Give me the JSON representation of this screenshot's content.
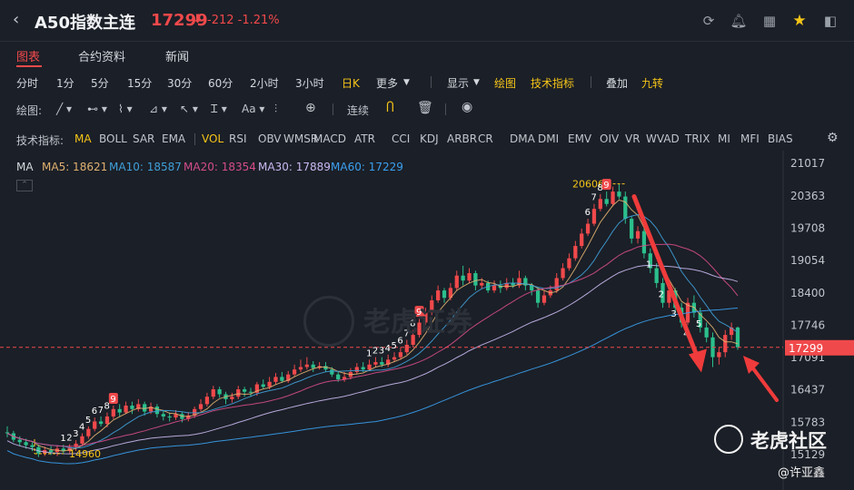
{
  "header": {
    "symbol": "A50指数主连",
    "price": "17299",
    "change": "-212 -1.21%",
    "icons": [
      "back-icon",
      "refresh-icon",
      "bell-icon",
      "grid-icon",
      "star-icon",
      "panel-icon"
    ]
  },
  "tabs": [
    "图表",
    "合约资料",
    "新闻"
  ],
  "periods": [
    "分时",
    "1分",
    "5分",
    "15分",
    "30分",
    "60分",
    "2小时",
    "3小时",
    "日K",
    "更多"
  ],
  "toolbar": {
    "display": "显示",
    "draw": "绘图",
    "tech": "技术指标",
    "overlay": "叠加",
    "nine": "九转"
  },
  "drawbar": {
    "label": "绘图:",
    "continuous": "连续"
  },
  "indicators": {
    "label": "技术指标:",
    "items": [
      "MA",
      "BOLL",
      "SAR",
      "EMA",
      "VOL",
      "RSI",
      "OBV",
      "WMSR",
      "MACD",
      "ATR",
      "CCI",
      "KDJ",
      "ARBR",
      "CR",
      "DMA",
      "DMI",
      "EMV",
      "OIV",
      "VR",
      "WVAD",
      "TRIX",
      "MI",
      "MFI",
      "BIAS"
    ]
  },
  "legend": {
    "title": "MA",
    "items": [
      {
        "label": "MA5: 18621",
        "color": "#e0b070"
      },
      {
        "label": "MA10: 18587",
        "color": "#3f9fd8"
      },
      {
        "label": "MA20: 18354",
        "color": "#d44d8a"
      },
      {
        "label": "MA30: 17889",
        "color": "#c8b8f0"
      },
      {
        "label": "MA60: 17229",
        "color": "#3aa0f0"
      }
    ]
  },
  "colors": {
    "up": "#f0494b",
    "down": "#2bbf8c",
    "accent": "#f0494b",
    "yellow": "#f5c518",
    "bg": "#1b1f27"
  },
  "watermark": "老虎证券",
  "brand": "老虎社区",
  "author": "@许亚鑫",
  "chart_data": {
    "type": "candlestick",
    "y_ticks": [
      21017,
      20363,
      19708,
      19054,
      18400,
      17746,
      17091,
      16437,
      15783,
      15129
    ],
    "ylim": [
      15000,
      21150
    ],
    "last_price": "17299",
    "high_label": "20606",
    "low_label": "14960",
    "td_labels_first": [
      "1",
      "2",
      "3",
      "4",
      "5",
      "6",
      "7",
      "8",
      "9"
    ],
    "td_labels_second": [
      "1",
      "2",
      "3",
      "4",
      "5",
      "6",
      "7",
      "8",
      "9"
    ],
    "td_labels_top": [
      "6",
      "7",
      "8",
      "9"
    ],
    "td_labels_down": [
      "1",
      "2",
      "3",
      "4",
      "5"
    ],
    "candles": [
      [
        15580,
        15560,
        15700,
        15480
      ],
      [
        15560,
        15430,
        15610,
        15380
      ],
      [
        15430,
        15380,
        15500,
        15300
      ],
      [
        15380,
        15320,
        15450,
        15250
      ],
      [
        15320,
        15280,
        15380,
        15200
      ],
      [
        15280,
        15150,
        15330,
        15080
      ],
      [
        15150,
        15220,
        15290,
        15100
      ],
      [
        15220,
        15180,
        15300,
        15120
      ],
      [
        15180,
        15250,
        15320,
        15100
      ],
      [
        15250,
        15200,
        15330,
        15150
      ],
      [
        15200,
        15280,
        15340,
        15150
      ],
      [
        15280,
        15350,
        15420,
        15200
      ],
      [
        15350,
        15500,
        15560,
        15300
      ],
      [
        15500,
        15650,
        15700,
        15450
      ],
      [
        15650,
        15800,
        15880,
        15600
      ],
      [
        15800,
        15750,
        15900,
        15700
      ],
      [
        15750,
        15900,
        15980,
        15680
      ],
      [
        15900,
        16050,
        16120,
        15850
      ],
      [
        16050,
        15980,
        16150,
        15900
      ],
      [
        15980,
        16120,
        16200,
        15950
      ],
      [
        16120,
        16050,
        16200,
        15950
      ],
      [
        16050,
        16150,
        16250,
        16000
      ],
      [
        16150,
        16000,
        16200,
        15920
      ],
      [
        16000,
        16100,
        16180,
        15950
      ],
      [
        16100,
        15950,
        16150,
        15880
      ],
      [
        15950,
        15900,
        16020,
        15820
      ],
      [
        15900,
        15880,
        15980,
        15800
      ],
      [
        15880,
        15950,
        16030,
        15830
      ],
      [
        15950,
        15850,
        16000,
        15780
      ],
      [
        15850,
        15920,
        15990,
        15800
      ],
      [
        15920,
        16050,
        16100,
        15870
      ],
      [
        16050,
        16150,
        16250,
        16000
      ],
      [
        16150,
        16300,
        16380,
        16100
      ],
      [
        16300,
        16450,
        16520,
        16250
      ],
      [
        16450,
        16350,
        16500,
        16280
      ],
      [
        16350,
        16250,
        16400,
        16150
      ],
      [
        16250,
        16300,
        16380,
        16180
      ],
      [
        16300,
        16450,
        16520,
        16250
      ],
      [
        16450,
        16400,
        16500,
        16300
      ],
      [
        16400,
        16380,
        16480,
        16300
      ],
      [
        16380,
        16550,
        16600,
        16320
      ],
      [
        16550,
        16500,
        16650,
        16450
      ],
      [
        16500,
        16600,
        16700,
        16450
      ],
      [
        16600,
        16700,
        16780,
        16550
      ],
      [
        16700,
        16620,
        16800,
        16580
      ],
      [
        16620,
        16750,
        16820,
        16580
      ],
      [
        16750,
        16850,
        16950,
        16700
      ],
      [
        16850,
        16900,
        17050,
        16800
      ],
      [
        16900,
        16950,
        17100,
        16850
      ],
      [
        16950,
        16880,
        17020,
        16800
      ],
      [
        16880,
        16920,
        17000,
        16850
      ],
      [
        16920,
        16850,
        17000,
        16800
      ],
      [
        16850,
        16750,
        16900,
        16700
      ],
      [
        16750,
        16650,
        16800,
        16600
      ],
      [
        16650,
        16700,
        16800,
        16600
      ],
      [
        16700,
        16800,
        16880,
        16650
      ],
      [
        16800,
        16900,
        16980,
        16750
      ],
      [
        16900,
        16850,
        17000,
        16800
      ],
      [
        16850,
        16950,
        17050,
        16820
      ],
      [
        16950,
        17000,
        17100,
        16900
      ],
      [
        17000,
        16950,
        17100,
        16900
      ],
      [
        16950,
        17050,
        17150,
        16900
      ],
      [
        17050,
        17100,
        17200,
        17000
      ],
      [
        17100,
        17200,
        17300,
        17050
      ],
      [
        17200,
        17350,
        17450,
        17150
      ],
      [
        17350,
        17550,
        17650,
        17300
      ],
      [
        17550,
        17800,
        17880,
        17500
      ],
      [
        17800,
        18000,
        18100,
        17750
      ],
      [
        18000,
        18250,
        18350,
        17950
      ],
      [
        18250,
        18450,
        18550,
        18200
      ],
      [
        18450,
        18300,
        18500,
        18200
      ],
      [
        18300,
        18500,
        18600,
        18250
      ],
      [
        18500,
        18750,
        18850,
        18450
      ],
      [
        18750,
        18650,
        18950,
        18550
      ],
      [
        18650,
        18800,
        18900,
        18600
      ],
      [
        18800,
        18550,
        18850,
        18450
      ],
      [
        18550,
        18600,
        18700,
        18480
      ],
      [
        18600,
        18450,
        18650,
        18400
      ],
      [
        18450,
        18550,
        18650,
        18400
      ],
      [
        18550,
        18500,
        18650,
        18400
      ],
      [
        18500,
        18600,
        18700,
        18450
      ],
      [
        18600,
        18550,
        18700,
        18500
      ],
      [
        18550,
        18700,
        18850,
        18500
      ],
      [
        18700,
        18550,
        18750,
        18450
      ],
      [
        18550,
        18450,
        18600,
        18350
      ],
      [
        18450,
        18200,
        18500,
        18100
      ],
      [
        18200,
        18350,
        18450,
        18150
      ],
      [
        18350,
        18450,
        18550,
        18300
      ],
      [
        18450,
        18700,
        18800,
        18400
      ],
      [
        18700,
        18900,
        19000,
        18650
      ],
      [
        18900,
        19100,
        19200,
        18850
      ],
      [
        19100,
        19350,
        19450,
        19050
      ],
      [
        19350,
        19600,
        19700,
        19300
      ],
      [
        19600,
        19800,
        19900,
        19550
      ],
      [
        19800,
        20100,
        20200,
        19750
      ],
      [
        20100,
        20300,
        20400,
        20050
      ],
      [
        20300,
        20200,
        20450,
        20150
      ],
      [
        20200,
        20450,
        20550,
        20150
      ],
      [
        20450,
        20350,
        20606,
        20300
      ],
      [
        20350,
        19900,
        20450,
        19800
      ],
      [
        19900,
        19500,
        19950,
        19400
      ],
      [
        19500,
        19650,
        19750,
        19400
      ],
      [
        19650,
        19200,
        19700,
        19100
      ],
      [
        19200,
        18900,
        19300,
        18800
      ],
      [
        18900,
        18600,
        19000,
        18500
      ],
      [
        18600,
        18200,
        18700,
        18100
      ],
      [
        18200,
        18450,
        18550,
        18100
      ],
      [
        18450,
        18100,
        18500,
        18000
      ],
      [
        18100,
        17800,
        18200,
        17700
      ],
      [
        17800,
        18200,
        18300,
        17750
      ],
      [
        18200,
        18000,
        18350,
        17900
      ],
      [
        18000,
        17700,
        18100,
        17600
      ],
      [
        17700,
        17500,
        17800,
        17400
      ],
      [
        17500,
        17100,
        17600,
        16900
      ],
      [
        17100,
        17200,
        17300,
        16950
      ],
      [
        17200,
        17550,
        17650,
        17100
      ],
      [
        17550,
        17700,
        17800,
        17450
      ],
      [
        17700,
        17299,
        17720,
        17250
      ]
    ]
  }
}
